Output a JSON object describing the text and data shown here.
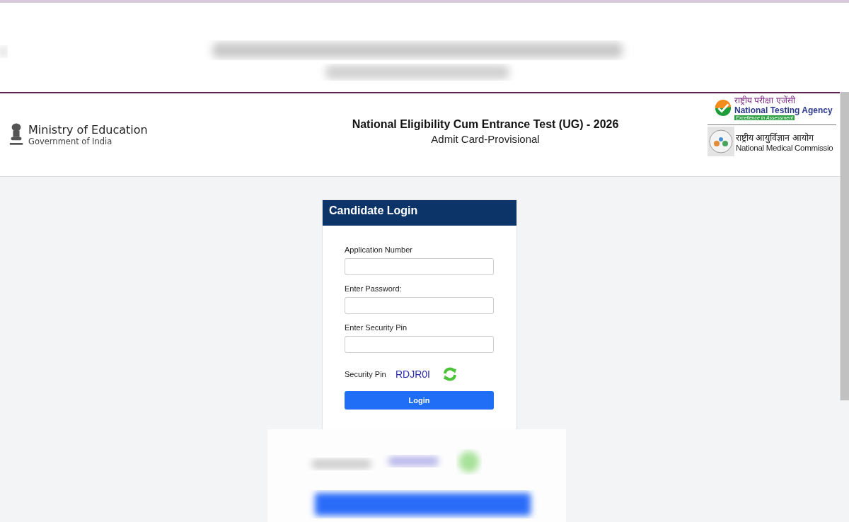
{
  "header": {
    "ministry": "Ministry of Education",
    "government": "Government of India",
    "title": "National Eligibility Cum Entrance Test (UG) - 2026",
    "subtitle": "Admit Card-Provisional",
    "nta": {
      "hindi": "राष्ट्रीय परीक्षा एजेंसी",
      "name": "National Testing Agency",
      "tagline": "Excellence in Assessment"
    },
    "nmc": {
      "hindi": "राष्ट्रीय आयुर्विज्ञान आयोग",
      "name": "National Medical Commissio"
    }
  },
  "login": {
    "title": "Candidate Login",
    "fields": [
      {
        "label": "Application Number"
      },
      {
        "label": "Enter Password:"
      },
      {
        "label": "Enter Security Pin"
      }
    ],
    "pin_label": "Security Pin",
    "pin": "RDJR0I",
    "button": "Login"
  }
}
